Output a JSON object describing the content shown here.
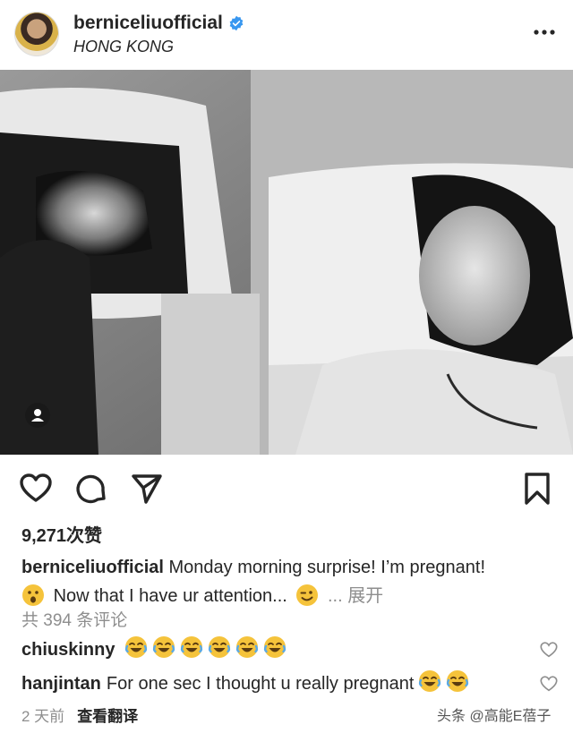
{
  "header": {
    "username": "berniceliuofficial",
    "location": "HONG KONG"
  },
  "post": {
    "likes": "9,271次赞",
    "caption_user": "berniceliuofficial",
    "caption_text_1": "Monday morning surprise! I’m pregnant!",
    "caption_text_2": "Now that I have ur attention...",
    "caption_ellipsis": "...",
    "caption_more": "展开",
    "comments_count": "共 394 条评论"
  },
  "comments": [
    {
      "user": "chiuskinny",
      "text": ""
    },
    {
      "user": "hanjintan",
      "text": "For one sec I thought u really pregnant"
    }
  ],
  "footer": {
    "time": "2 天前",
    "translate": "查看翻译",
    "watermark": "头条 @高能E蓓子"
  },
  "colors": {
    "text": "#262626",
    "muted": "#8e8e8e",
    "verified": "#3897f0",
    "emoji_yellow": "#f5c33b"
  },
  "icons": [
    "verified-icon",
    "more-icon",
    "heart-icon",
    "comment-icon",
    "share-icon",
    "bookmark-icon",
    "user-tag-icon",
    "laughing-emoji-icon",
    "surprised-emoji-icon",
    "winking-emoji-icon"
  ]
}
